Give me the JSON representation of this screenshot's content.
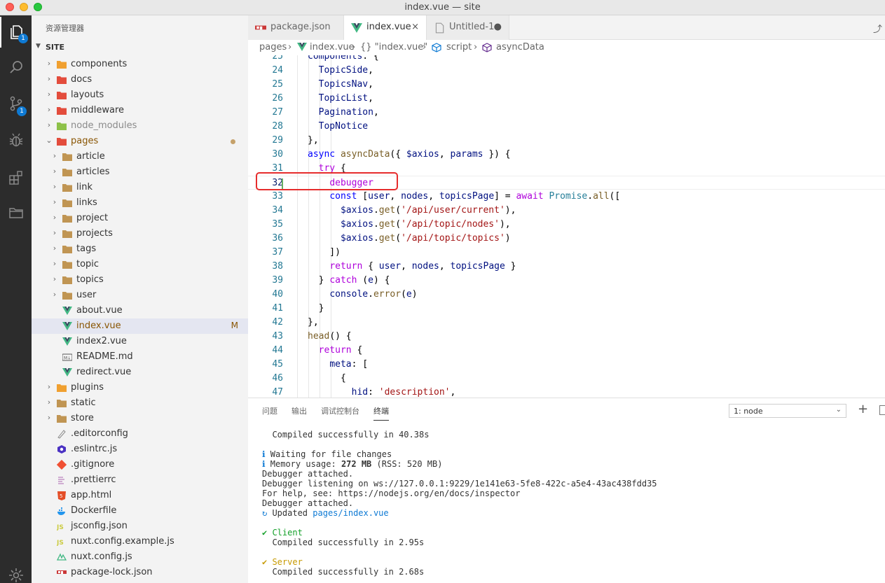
{
  "window": {
    "title": "index.vue — site"
  },
  "activity": {
    "explorer_badge": "1",
    "scm_badge": "1"
  },
  "sidebar": {
    "title": "资源管理器",
    "section": "SITE",
    "items": [
      {
        "name": "components",
        "kind": "folder",
        "color": "#f0a030",
        "expanded": false,
        "depth": 0
      },
      {
        "name": "docs",
        "kind": "folder",
        "color": "#e34c3c",
        "expanded": false,
        "depth": 0
      },
      {
        "name": "layouts",
        "kind": "folder",
        "color": "#e34c3c",
        "expanded": false,
        "depth": 0
      },
      {
        "name": "middleware",
        "kind": "folder",
        "color": "#e34c3c",
        "expanded": false,
        "depth": 0
      },
      {
        "name": "node_modules",
        "kind": "folder",
        "color": "#8dc149",
        "expanded": false,
        "depth": 0,
        "dim": true
      },
      {
        "name": "pages",
        "kind": "folder",
        "color": "#e34c3c",
        "expanded": true,
        "depth": 0,
        "modified": true
      },
      {
        "name": "article",
        "kind": "folder",
        "color": "#c09553",
        "expanded": false,
        "depth": 1
      },
      {
        "name": "articles",
        "kind": "folder",
        "color": "#c09553",
        "expanded": false,
        "depth": 1
      },
      {
        "name": "link",
        "kind": "folder",
        "color": "#c09553",
        "expanded": false,
        "depth": 1
      },
      {
        "name": "links",
        "kind": "folder",
        "color": "#c09553",
        "expanded": false,
        "depth": 1
      },
      {
        "name": "project",
        "kind": "folder",
        "color": "#c09553",
        "expanded": false,
        "depth": 1
      },
      {
        "name": "projects",
        "kind": "folder",
        "color": "#c09553",
        "expanded": false,
        "depth": 1
      },
      {
        "name": "tags",
        "kind": "folder",
        "color": "#c09553",
        "expanded": false,
        "depth": 1
      },
      {
        "name": "topic",
        "kind": "folder",
        "color": "#c09553",
        "expanded": false,
        "depth": 1
      },
      {
        "name": "topics",
        "kind": "folder",
        "color": "#c09553",
        "expanded": false,
        "depth": 1
      },
      {
        "name": "user",
        "kind": "folder",
        "color": "#c09553",
        "expanded": false,
        "depth": 1
      },
      {
        "name": "about.vue",
        "kind": "vue",
        "depth": 1
      },
      {
        "name": "index.vue",
        "kind": "vue",
        "depth": 1,
        "selected": true,
        "status": "M"
      },
      {
        "name": "index2.vue",
        "kind": "vue",
        "depth": 1
      },
      {
        "name": "README.md",
        "kind": "md",
        "depth": 1
      },
      {
        "name": "redirect.vue",
        "kind": "vue",
        "depth": 1
      },
      {
        "name": "plugins",
        "kind": "folder",
        "color": "#f0a030",
        "expanded": false,
        "depth": 0
      },
      {
        "name": "static",
        "kind": "folder",
        "color": "#c09553",
        "expanded": false,
        "depth": 0
      },
      {
        "name": "store",
        "kind": "folder",
        "color": "#c09553",
        "expanded": false,
        "depth": 0
      },
      {
        "name": ".editorconfig",
        "kind": "editorconfig",
        "depth": 0
      },
      {
        "name": ".eslintrc.js",
        "kind": "eslint",
        "depth": 0
      },
      {
        "name": ".gitignore",
        "kind": "git",
        "depth": 0
      },
      {
        "name": ".prettierrc",
        "kind": "prettier",
        "depth": 0
      },
      {
        "name": "app.html",
        "kind": "html",
        "depth": 0
      },
      {
        "name": "Dockerfile",
        "kind": "docker",
        "depth": 0
      },
      {
        "name": "jsconfig.json",
        "kind": "js",
        "depth": 0
      },
      {
        "name": "nuxt.config.example.js",
        "kind": "js",
        "depth": 0
      },
      {
        "name": "nuxt.config.js",
        "kind": "nuxt",
        "depth": 0
      },
      {
        "name": "package-lock.json",
        "kind": "npm",
        "depth": 0
      },
      {
        "name": "package.json",
        "kind": "npm",
        "depth": 0
      }
    ]
  },
  "tabs": [
    {
      "label": "package.json",
      "icon": "npm"
    },
    {
      "label": "index.vue",
      "icon": "vue",
      "active": true,
      "close": "×"
    },
    {
      "label": "Untitled-1",
      "icon": "file",
      "dirty": "●"
    }
  ],
  "breadcrumb": {
    "pages": "pages",
    "sep": "›",
    "file": "index.vue",
    "obj": "{} \"index.vue\"",
    "script": "script",
    "fn": "asyncData"
  },
  "code": {
    "current_line": 32,
    "lines": [
      {
        "n": "25",
        "html": "<span class=\"v\">components</span>: {"
      },
      {
        "n": "24",
        "html": "  <span class=\"v\">TopicSide</span>,"
      },
      {
        "n": "25",
        "html": "  <span class=\"v\">TopicsNav</span>,"
      },
      {
        "n": "26",
        "html": "  <span class=\"v\">TopicList</span>,"
      },
      {
        "n": "27",
        "html": "  <span class=\"v\">Pagination</span>,"
      },
      {
        "n": "28",
        "html": "  <span class=\"v\">TopNotice</span>"
      },
      {
        "n": "29",
        "html": "},"
      },
      {
        "n": "30",
        "html": "<span class=\"k\">async</span> <span class=\"f\">asyncData</span>({ <span class=\"v\">$axios</span>, <span class=\"v\">params</span> }) {"
      },
      {
        "n": "31",
        "html": "  <span class=\"kc\">try</span> {"
      },
      {
        "n": "32",
        "html": "    <span class=\"kc\">debugger</span>"
      },
      {
        "n": "33",
        "html": "    <span class=\"k\">const</span> [<span class=\"v\">user</span>, <span class=\"v\">nodes</span>, <span class=\"v\">topicsPage</span>] = <span class=\"kc\">await</span> <span class=\"t\">Promise</span>.<span class=\"f\">all</span>(["
      },
      {
        "n": "34",
        "html": "      <span class=\"v\">$axios</span>.<span class=\"f\">get</span>(<span class=\"s\">'/api/user/current'</span>),"
      },
      {
        "n": "35",
        "html": "      <span class=\"v\">$axios</span>.<span class=\"f\">get</span>(<span class=\"s\">'/api/topic/nodes'</span>),"
      },
      {
        "n": "36",
        "html": "      <span class=\"v\">$axios</span>.<span class=\"f\">get</span>(<span class=\"s\">'/api/topic/topics'</span>)"
      },
      {
        "n": "37",
        "html": "    ])"
      },
      {
        "n": "38",
        "html": "    <span class=\"kc\">return</span> { <span class=\"v\">user</span>, <span class=\"v\">nodes</span>, <span class=\"v\">topicsPage</span> }"
      },
      {
        "n": "39",
        "html": "  } <span class=\"kc\">catch</span> (<span class=\"v\">e</span>) {"
      },
      {
        "n": "40",
        "html": "    <span class=\"v\">console</span>.<span class=\"f\">error</span>(<span class=\"v\">e</span>)"
      },
      {
        "n": "41",
        "html": "  }"
      },
      {
        "n": "42",
        "html": "},"
      },
      {
        "n": "43",
        "html": "<span class=\"f\">head</span>() {"
      },
      {
        "n": "44",
        "html": "  <span class=\"kc\">return</span> {"
      },
      {
        "n": "45",
        "html": "    <span class=\"v\">meta</span>: ["
      },
      {
        "n": "46",
        "html": "      {"
      },
      {
        "n": "47",
        "html": "        <span class=\"v\">hid</span>: <span class=\"s\">'description'</span>,"
      }
    ]
  },
  "panel": {
    "tabs": [
      "问题",
      "输出",
      "调试控制台",
      "终端"
    ],
    "active_tab": "终端",
    "terminal_select": "1: node",
    "plus": "+",
    "terminal": [
      {
        "html": "  Compiled successfully in 40.38s"
      },
      {
        "html": ""
      },
      {
        "html": "<span class=\"info\">ℹ</span> Waiting for file changes"
      },
      {
        "html": "<span class=\"info\">ℹ</span> Memory usage: <b>272 MB</b> (RSS: 520 MB)"
      },
      {
        "html": "Debugger attached."
      },
      {
        "html": "Debugger listening on ws://127.0.0.1:9229/1e141e63-5fe8-422c-a5e4-43ac438fdd35"
      },
      {
        "html": "For help, see: https://nodejs.org/en/docs/inspector"
      },
      {
        "html": "Debugger attached."
      },
      {
        "html": "<span class=\"info\">↻</span> Updated <span class=\"link\">pages/index.vue</span>"
      },
      {
        "html": ""
      },
      {
        "html": "<span class=\"green\">✔ Client</span>"
      },
      {
        "html": "  Compiled successfully in 2.95s"
      },
      {
        "html": ""
      },
      {
        "html": "<span class=\"yellow\">✔ Server</span>"
      },
      {
        "html": "  Compiled successfully in 2.68s"
      }
    ]
  }
}
